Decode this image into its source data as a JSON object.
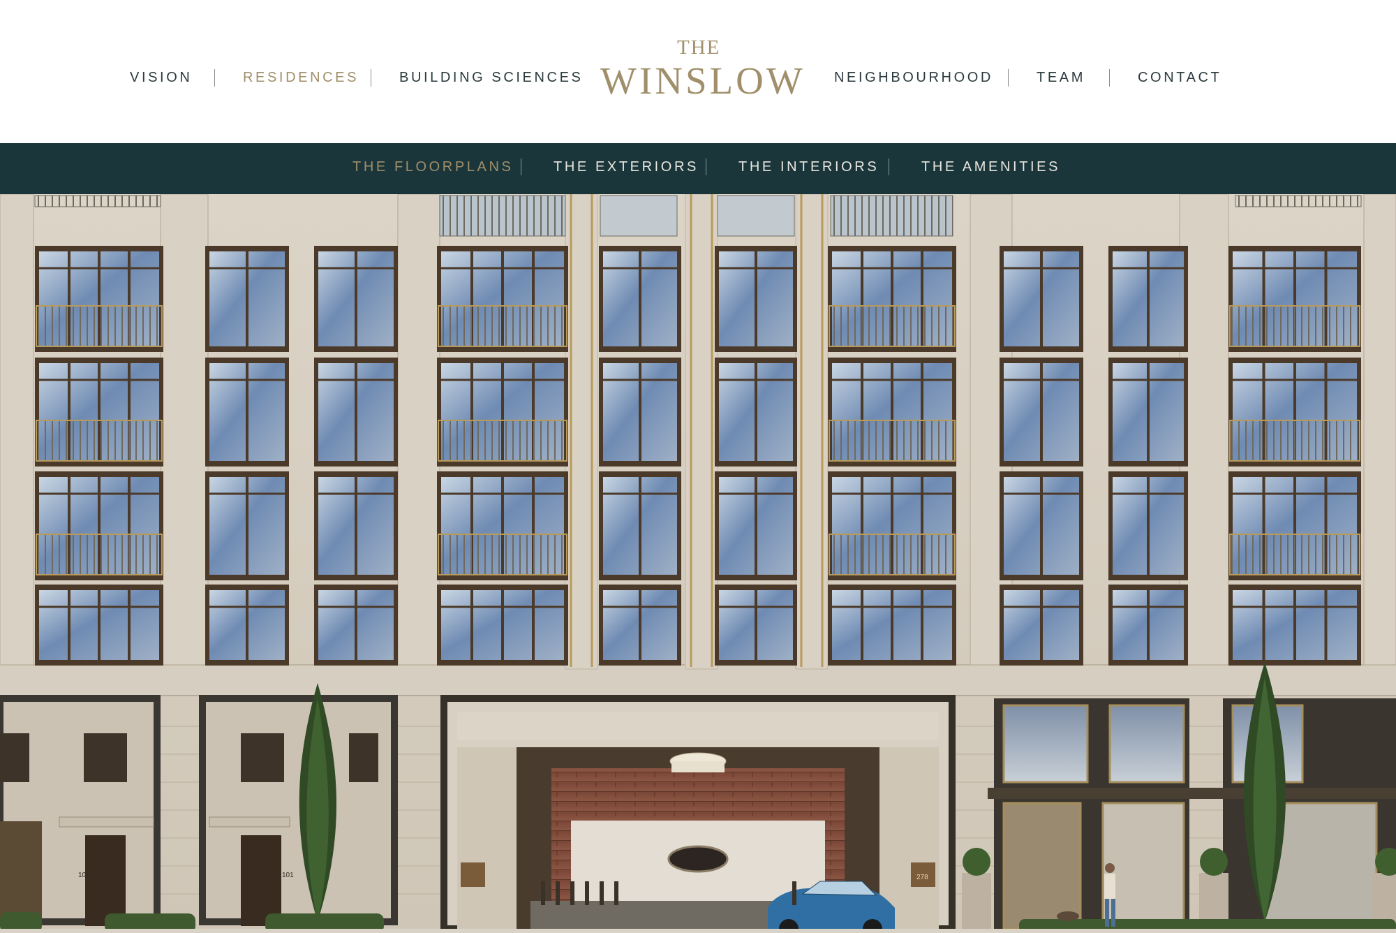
{
  "brand": {
    "the": "THE",
    "name": "WINSLOW",
    "color": "#a08f6a"
  },
  "nav": {
    "left": [
      {
        "label": "VISION"
      },
      {
        "label": "RESIDENCES",
        "active": true
      },
      {
        "label": "BUILDING SCIENCES"
      }
    ],
    "right": [
      {
        "label": "NEIGHBOURHOOD"
      },
      {
        "label": "TEAM"
      },
      {
        "label": "CONTACT"
      }
    ]
  },
  "subnav": {
    "background": "#1b363b",
    "items": [
      {
        "label": "THE FLOORPLANS",
        "active": true
      },
      {
        "label": "THE EXTERIORS"
      },
      {
        "label": "THE INTERIORS"
      },
      {
        "label": "THE AMENITIES"
      }
    ]
  },
  "hero": {
    "unit_numbers": [
      "102",
      "101"
    ],
    "address": "278"
  }
}
